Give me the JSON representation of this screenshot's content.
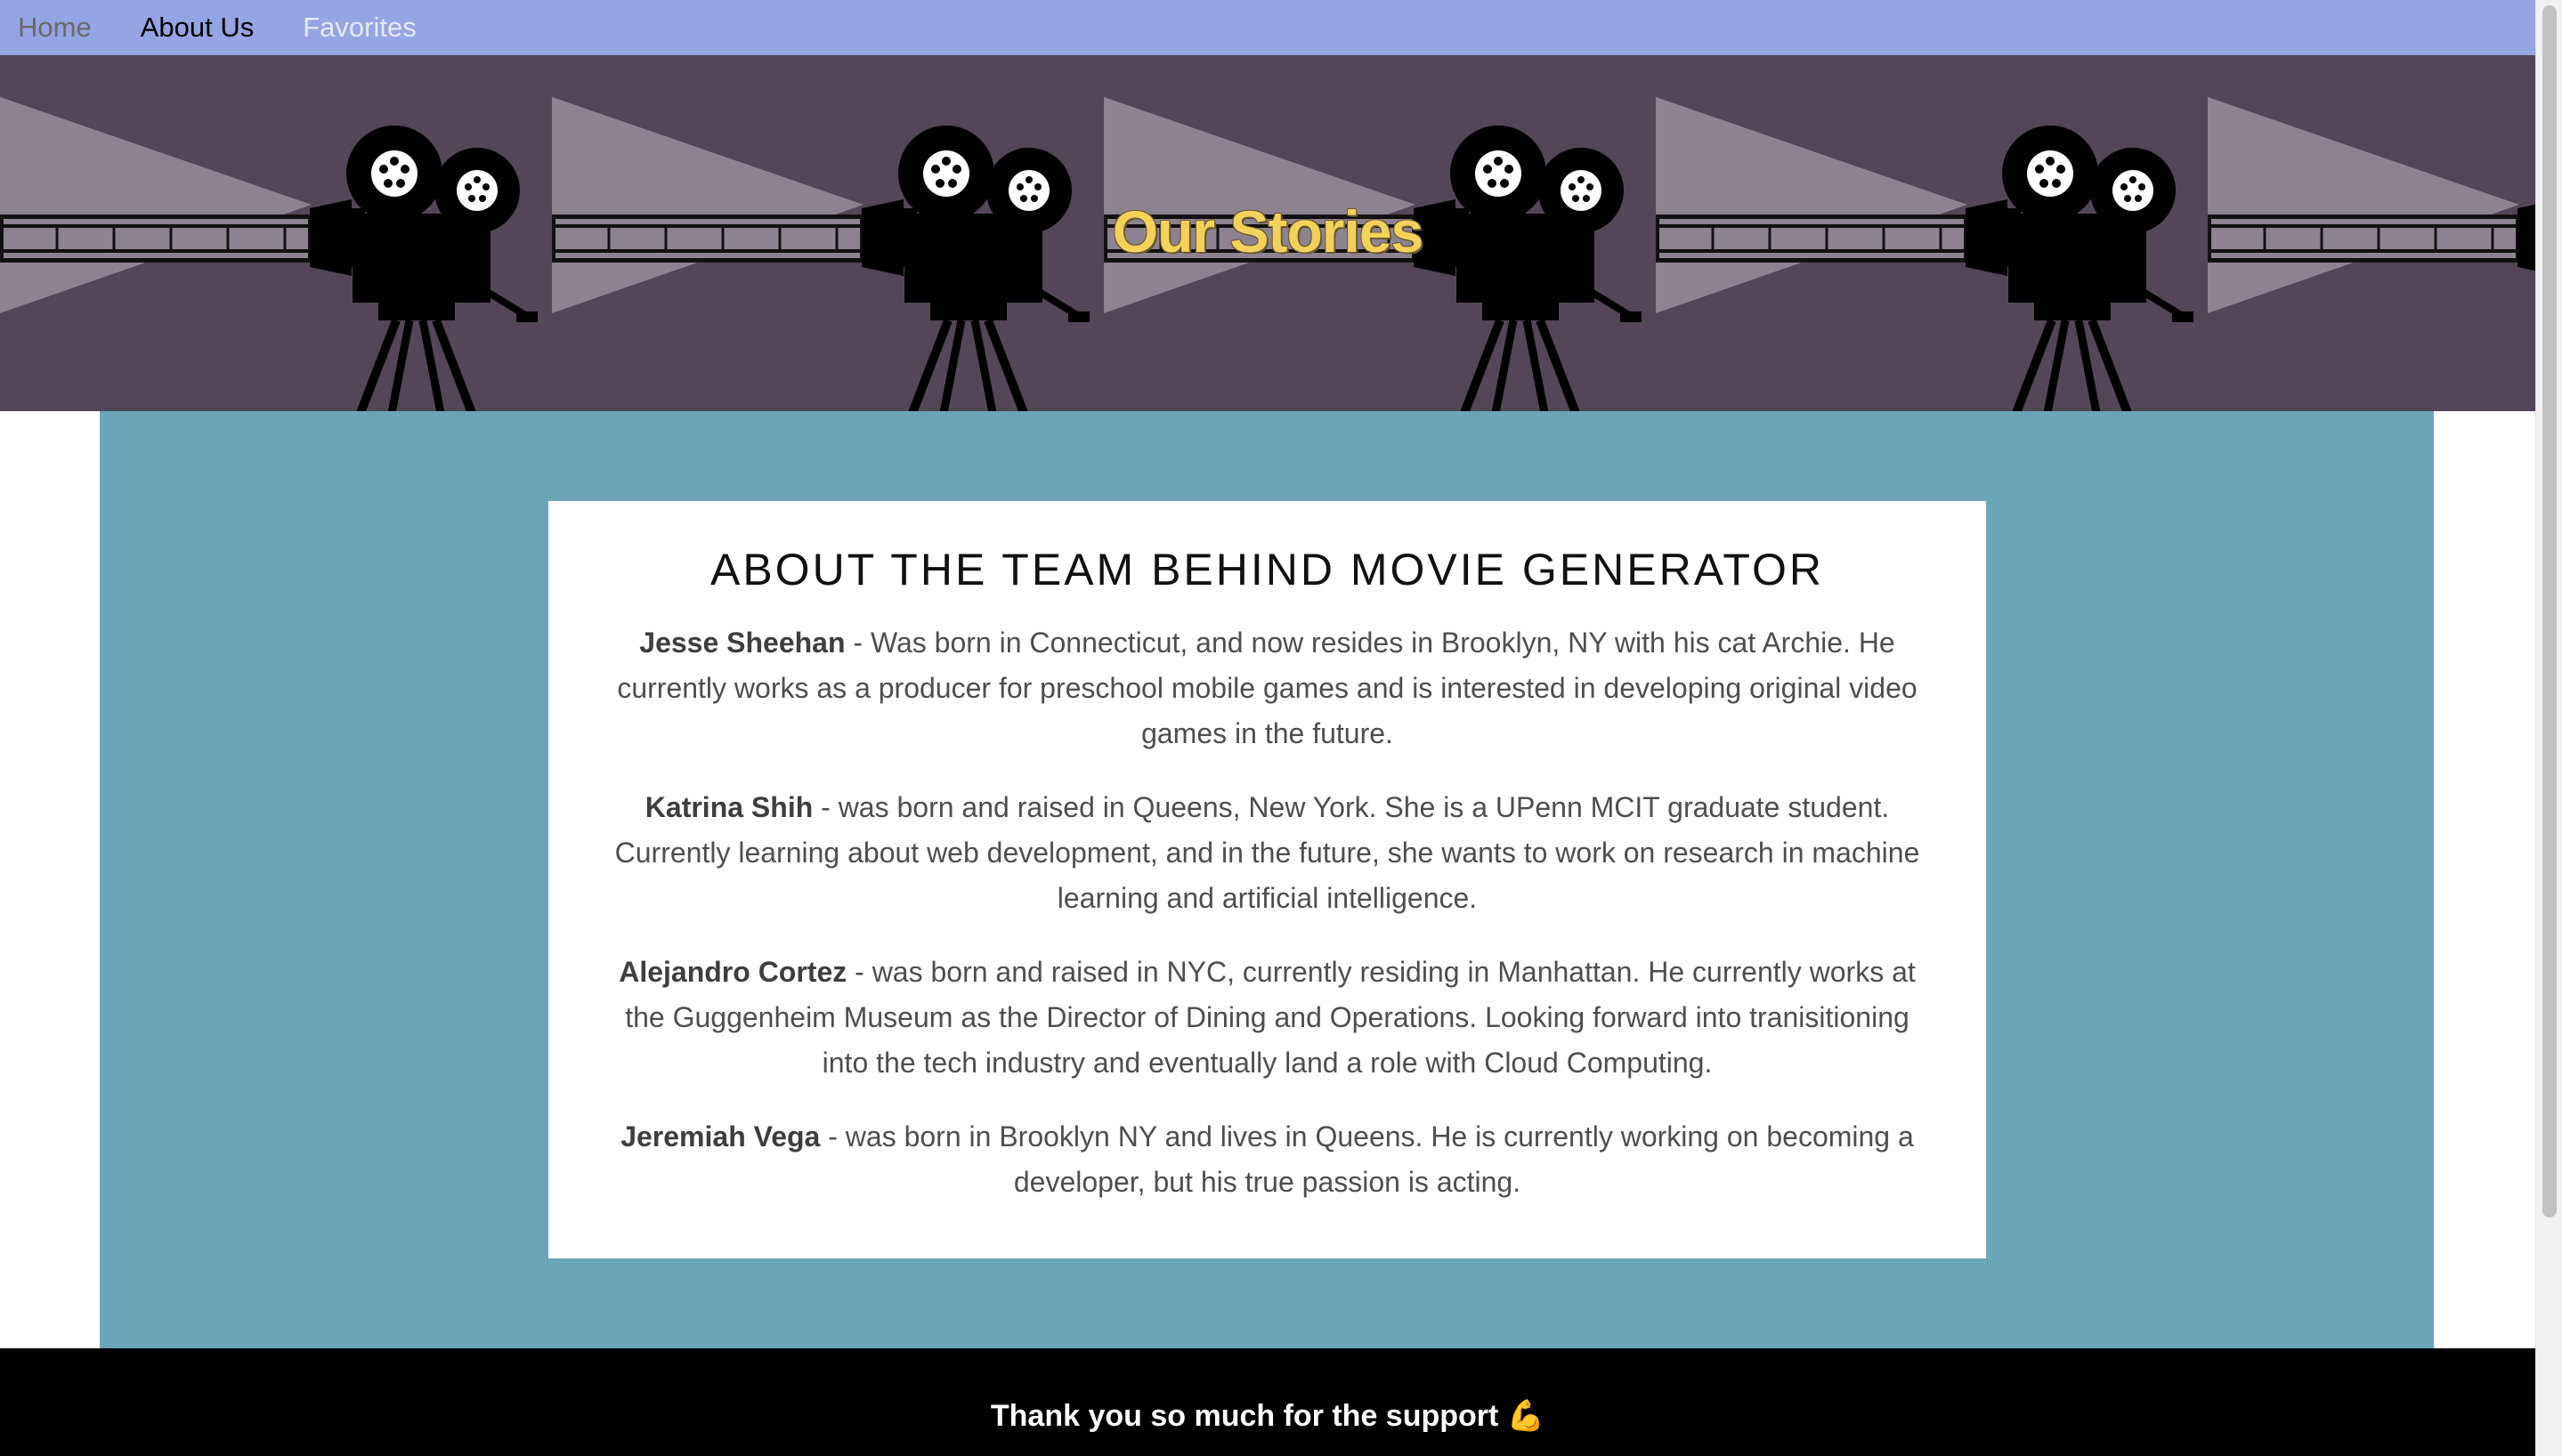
{
  "nav": {
    "home": "Home",
    "about": "About Us",
    "favorites": "Favorites"
  },
  "banner": {
    "title": "Our Stories",
    "decoration": "film-camera-icon"
  },
  "card": {
    "heading": "ABOUT THE TEAM BEHIND MOVIE GENERATOR",
    "bios": [
      {
        "name": "Jesse Sheehan",
        "text": " - Was born in Connecticut, and now resides in Brooklyn, NY with his cat Archie. He currently works as a producer for preschool mobile games and is interested in developing original video games in the future."
      },
      {
        "name": "Katrina Shih",
        "text": " - was born and raised in Queens, New York. She is a UPenn MCIT graduate student. Currently learning about web development, and in the future, she wants to work on research in machine learning and artificial intelligence."
      },
      {
        "name": "Alejandro Cortez",
        "text": " - was born and raised in NYC, currently residing in Manhattan. He currently works at the Guggenheim Museum as the Director of Dining and Operations. Looking forward into tranisitioning into the tech industry and eventually land a role with Cloud Computing."
      },
      {
        "name": "Jeremiah Vega",
        "text": " - was born in Brooklyn NY and lives in Queens. He is currently working on becoming a developer, but his true passion is acting."
      }
    ]
  },
  "footer": {
    "text": "Thank you so much for the support 💪"
  },
  "colors": {
    "nav": "#95a4e2",
    "banner": "#534657",
    "main": "#6ca4b8",
    "title": "#f3d25a",
    "footer": "#000000"
  }
}
